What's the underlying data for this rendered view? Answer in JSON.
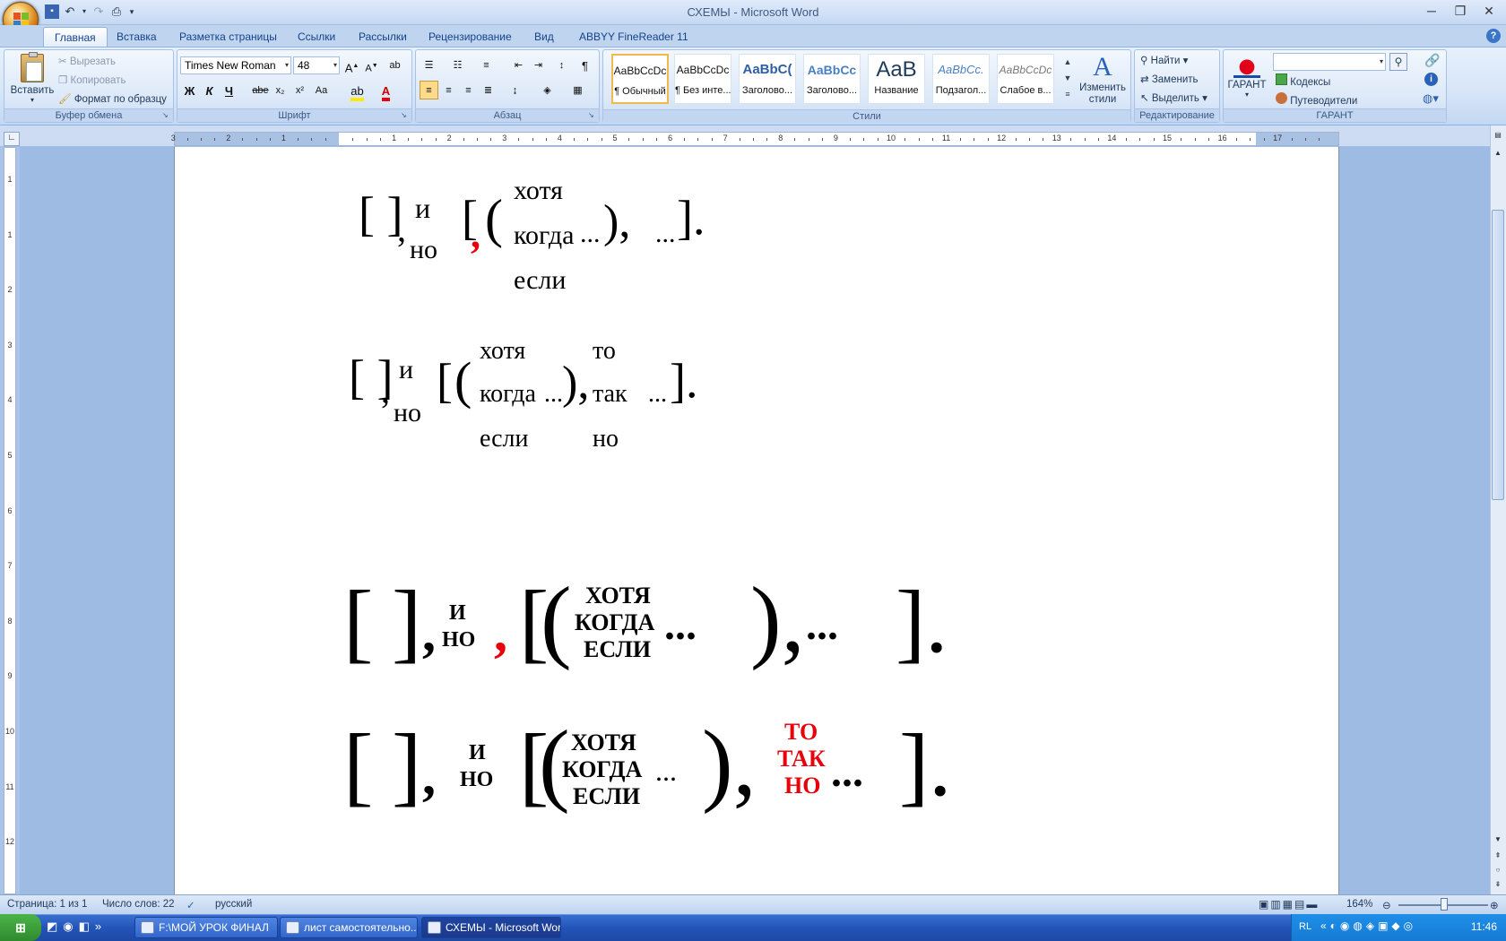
{
  "window": {
    "title": "СХЕМЫ - Microsoft Word"
  },
  "tabs": [
    "Главная",
    "Вставка",
    "Разметка страницы",
    "Ссылки",
    "Рассылки",
    "Рецензирование",
    "Вид",
    "ABBYY FineReader 11"
  ],
  "clipboard": {
    "paste": "Вставить",
    "cut": "Вырезать",
    "copy": "Копировать",
    "format_painter": "Формат по образцу",
    "label": "Буфер обмена"
  },
  "font": {
    "name": "Times New Roman",
    "size": "48",
    "label": "Шрифт",
    "bold": "Ж",
    "italic": "К",
    "underline": "Ч",
    "strike": "abe",
    "sub": "x₂",
    "sup": "x²",
    "case": "Aa"
  },
  "paragraph": {
    "label": "Абзац",
    "pilcrow": "¶"
  },
  "styles": {
    "label": "Стили",
    "items": [
      {
        "sample": "AaBbCcDc",
        "name": "¶ Обычный"
      },
      {
        "sample": "AaBbCcDc",
        "name": "¶ Без инте..."
      },
      {
        "sample": "AaBbC(",
        "name": "Заголово..."
      },
      {
        "sample": "AaBbCc",
        "name": "Заголово..."
      },
      {
        "sample": "AaB",
        "name": "Название"
      },
      {
        "sample": "AaBbCc.",
        "name": "Подзагол..."
      },
      {
        "sample": "AaBbCcDc",
        "name": "Слабое в..."
      }
    ],
    "change": "Изменить стили"
  },
  "editing": {
    "label": "Редактирование",
    "find": "Найти",
    "replace": "Заменить",
    "select": "Выделить"
  },
  "garant": {
    "label": "ГАРАНТ",
    "button": "ГАРАНТ",
    "codes": "Кодексы",
    "guides": "Путеводители"
  },
  "ruler_numbers": [
    "3",
    "2",
    "1",
    "1",
    "2",
    "3",
    "4",
    "5",
    "6",
    "7",
    "8",
    "9",
    "10",
    "11",
    "12",
    "13",
    "14",
    "15",
    "16",
    "17"
  ],
  "vruler_numbers": [
    "1",
    "1",
    "2",
    "3",
    "4",
    "5",
    "6",
    "7",
    "8",
    "9",
    "10",
    "11",
    "12"
  ],
  "schemas": {
    "s1": {
      "open": "[ ]",
      "comma": ",",
      "c1": "и",
      "c2": "но",
      "comma_red": ",",
      "bracket": "[",
      "paren": "(",
      "w1": "хотя",
      "w2": "когда",
      "w3": "если",
      "dots": "...",
      "close": "),",
      "dots2": "...",
      "end": "]."
    },
    "s2": {
      "open": "[ ]",
      "comma": ",",
      "c1": "и",
      "c2": "но",
      "bracket": "[",
      "paren": "(",
      "w1": "хотя",
      "w2": "когда",
      "w3": "если",
      "dots": "...",
      "close": "),",
      "t1": "то",
      "t2": "так",
      "t3": "но",
      "dots2": "...",
      "end": "]."
    },
    "s3": {
      "open": "[",
      "close1": "]",
      "comma": ",",
      "c1": "И",
      "c2": "НО",
      "comma_red": ",",
      "bracket": "[",
      "paren": "(",
      "w1": "ХОТЯ",
      "w2": "КОГДА",
      "w3": "ЕСЛИ",
      "dots": "...",
      "close": "),",
      "dots2": "...",
      "end": "]."
    },
    "s4": {
      "open": "[",
      "close1": "]",
      "comma": ",",
      "c1": "И",
      "c2": "НО",
      "bracket": "[",
      "paren": "(",
      "w1": "ХОТЯ",
      "w2": "КОГДА",
      "w3": "ЕСЛИ",
      "dots": "...",
      "close": "),",
      "t1": "ТО",
      "t2": "ТАК",
      "t3": "НО",
      "dots2": "...",
      "end": "]."
    }
  },
  "status": {
    "page": "Страница: 1 из 1",
    "words": "Число слов: 22",
    "lang": "русский",
    "zoom": "164%"
  },
  "taskbar": {
    "items": [
      "F:\\МОЙ УРОК ФИНАЛ",
      "лист самостоятельно...",
      "СХЕМЫ - Microsoft Word"
    ],
    "lang": "RL",
    "time": "11:46"
  },
  "colors": {
    "red": "#e8000b",
    "accent": "#15428b"
  }
}
